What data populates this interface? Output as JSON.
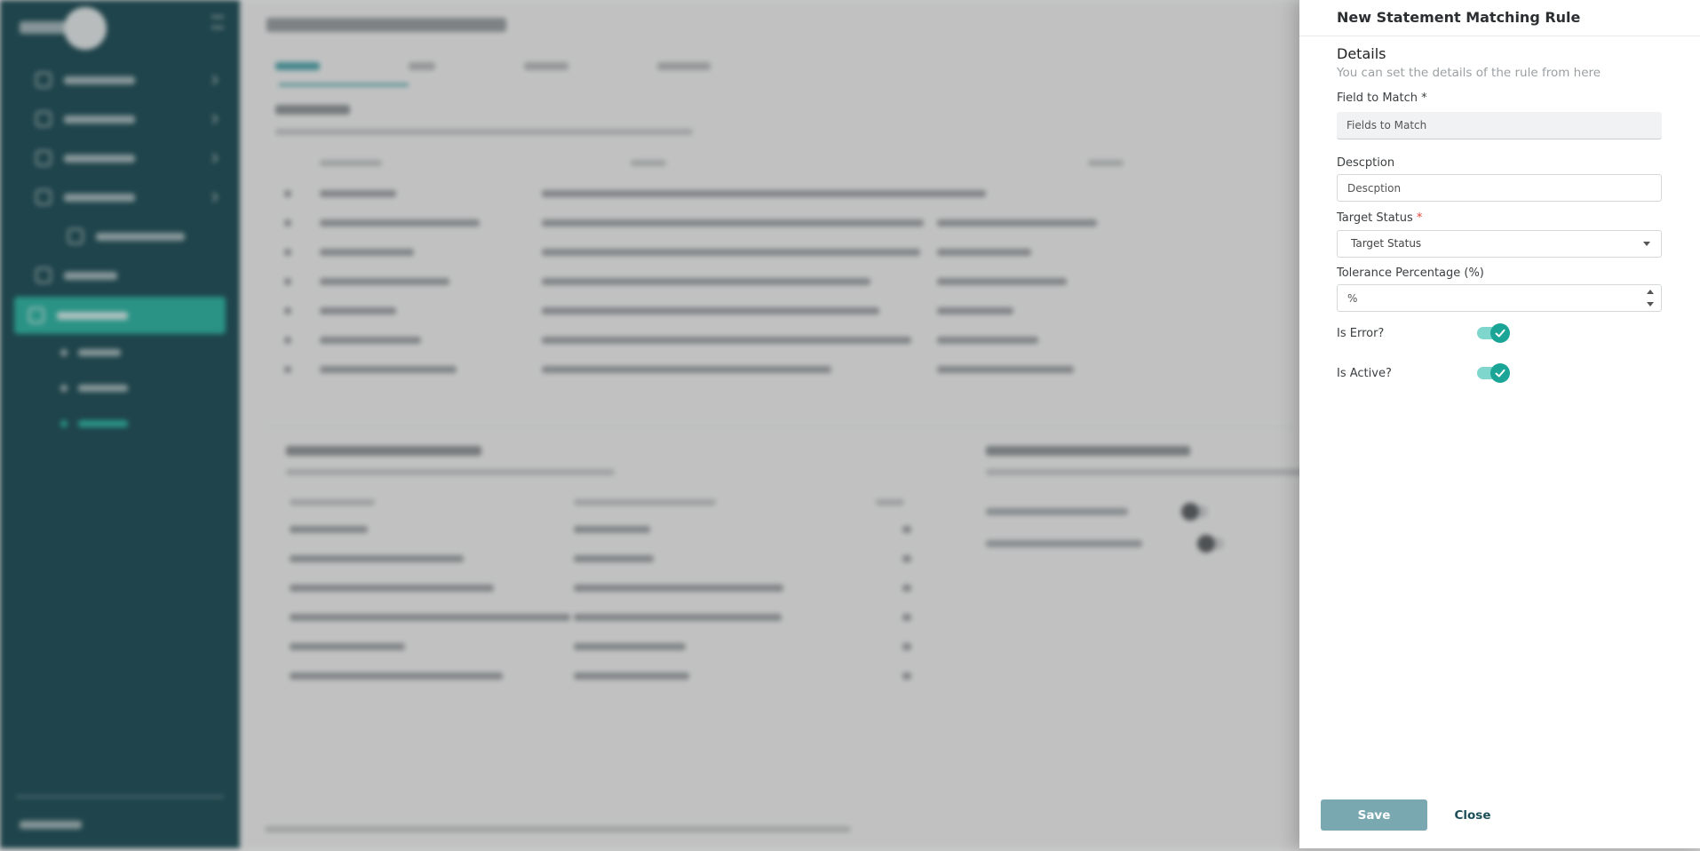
{
  "panel": {
    "title": "New Statement Matching Rule",
    "section_title": "Details",
    "section_subtitle": "You can set the details of the rule from here",
    "fields": {
      "field_to_match": {
        "label": "Field to Match",
        "required_mark": "*",
        "placeholder": "Fields to Match"
      },
      "description": {
        "label": "Descption",
        "placeholder": "Descption"
      },
      "target_status": {
        "label": "Target Status",
        "required_mark": "*",
        "placeholder": "Target Status"
      },
      "tolerance": {
        "label": "Tolerance Percentage (%)",
        "placeholder": "%"
      }
    },
    "toggles": {
      "is_error": {
        "label": "Is Error?",
        "checked": true
      },
      "is_active": {
        "label": "Is Active?",
        "checked": true
      }
    },
    "buttons": {
      "save": "Save",
      "close": "Close"
    },
    "colors": {
      "accent": "#1aa596",
      "save_button": "#7aa8b0",
      "brand_dark": "#1c4e57"
    }
  },
  "background": {
    "colors": {
      "sidebar": "#1c4e57",
      "active_nav": "#2bb7a5"
    }
  }
}
